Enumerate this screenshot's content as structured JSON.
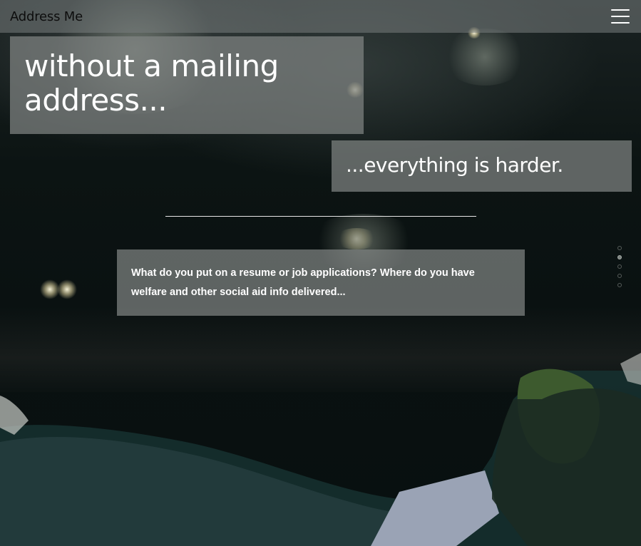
{
  "navbar": {
    "brand": "Address Me",
    "menu_icon": "hamburger-menu-icon"
  },
  "hero": {
    "headline": "without a mailing address...",
    "subheadline": "...everything is harder.",
    "body": "What do you put on a resume or job applications? Where do you have welfare and other social aid info delivered..."
  },
  "pager": {
    "dot_count": 5,
    "active_index": 1
  },
  "colors": {
    "nav_bg": "#7d8282",
    "card_bg": "#808482",
    "text_light": "#ffffff",
    "brand_text": "#0d0d0d"
  }
}
